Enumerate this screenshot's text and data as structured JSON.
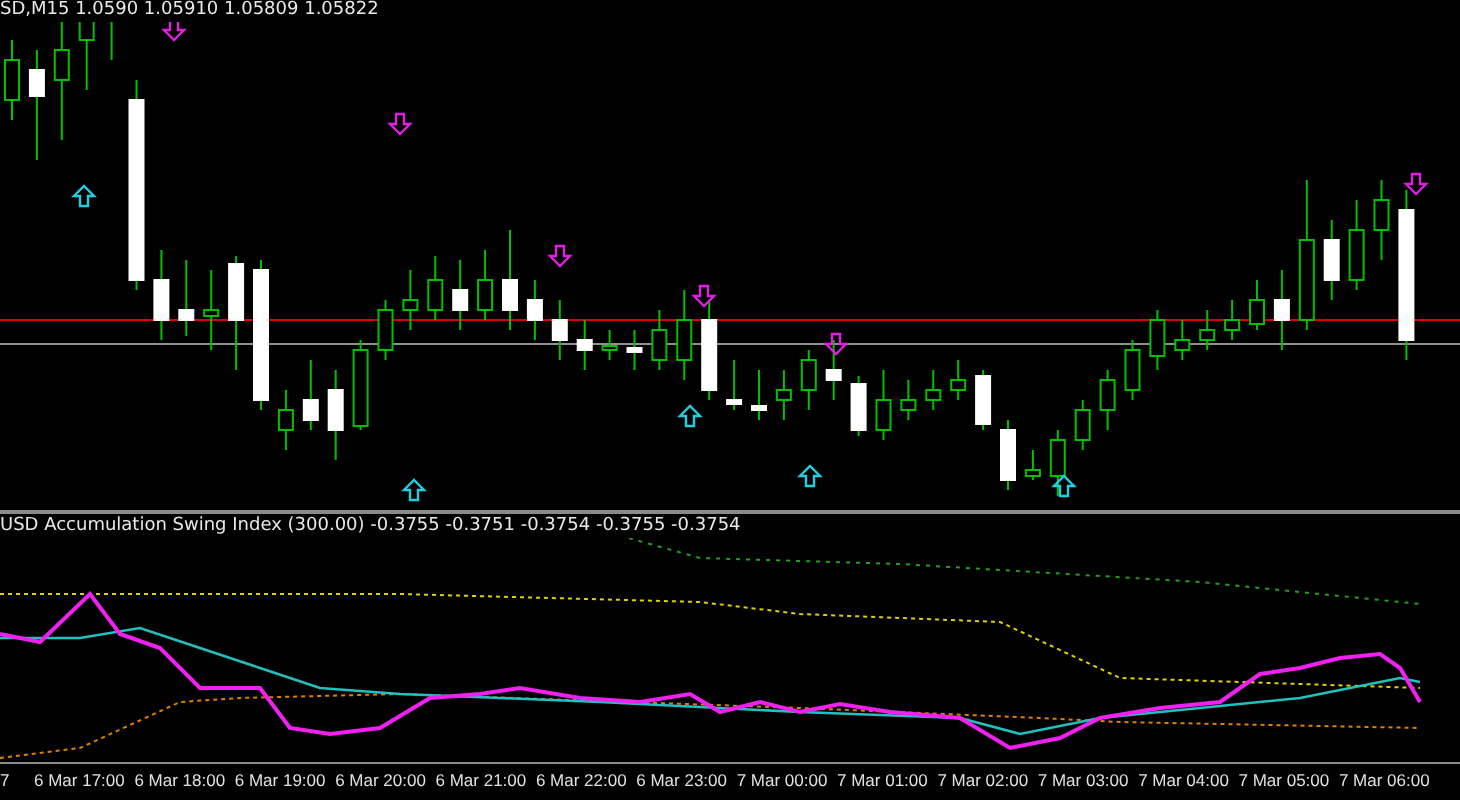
{
  "chart": {
    "title": "SD,M15 1.0590 1.05910 1.05809 1.05822"
  },
  "indicator": {
    "title": "USD Accumulation Swing Index (300.00) -0.3755 -0.3751 -0.3754 -0.3755 -0.3754"
  },
  "time_axis": {
    "labels": [
      "7",
      "6 Mar 17:00",
      "6 Mar 18:00",
      "6 Mar 19:00",
      "6 Mar 20:00",
      "6 Mar 21:00",
      "6 Mar 22:00",
      "6 Mar 23:00",
      "7 Mar 00:00",
      "7 Mar 01:00",
      "7 Mar 02:00",
      "7 Mar 03:00",
      "7 Mar 04:00",
      "7 Mar 05:00",
      "7 Mar 06:00"
    ]
  }
}
